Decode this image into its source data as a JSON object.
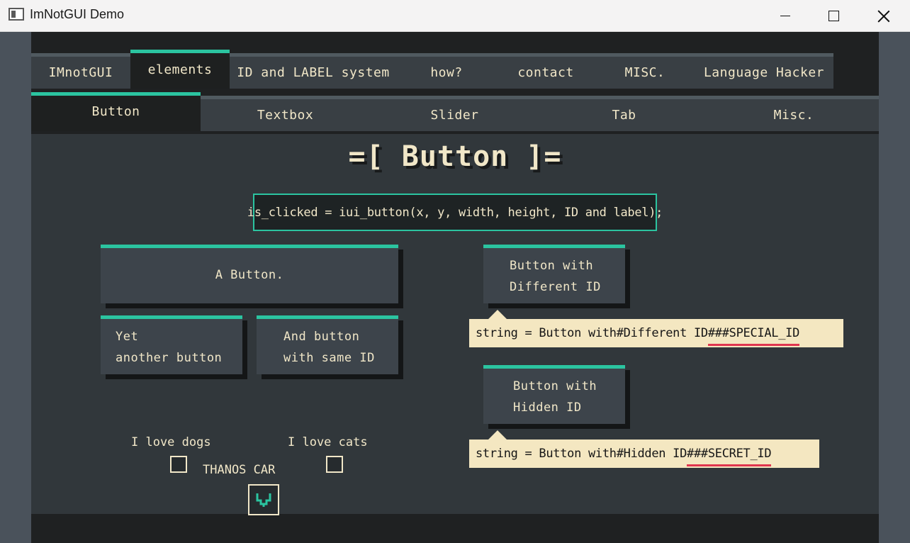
{
  "window": {
    "title": "ImNotGUI Demo",
    "icons": {
      "app": "app-window-icon",
      "minimize": "minimize-icon",
      "maximize": "maximize-icon",
      "close": "close-icon"
    }
  },
  "main_tabs": [
    {
      "label": "IMnotGUI",
      "active": false
    },
    {
      "label": "elements",
      "active": true
    },
    {
      "label": "ID and LABEL system",
      "active": false
    },
    {
      "label": "how?",
      "active": false
    },
    {
      "label": "contact",
      "active": false
    },
    {
      "label": "MISC.",
      "active": false
    },
    {
      "label": "Language Hacker",
      "active": false
    }
  ],
  "sub_tabs": [
    {
      "label": "Button",
      "active": true
    },
    {
      "label": "Textbox",
      "active": false
    },
    {
      "label": "Slider",
      "active": false
    },
    {
      "label": "Tab",
      "active": false
    },
    {
      "label": "Misc.",
      "active": false
    }
  ],
  "heading": "=[ Button ]=",
  "code": "is_clicked = iui_button(x, y, width, height, ID and label);",
  "buttons": {
    "a_button": "A Button.",
    "yet_another": "Yet\nanother button",
    "same_id": "And button\nwith same ID",
    "different_id": "Button with\nDifferent ID",
    "hidden_id": "Button with\nHidden ID"
  },
  "tooltips": {
    "different_prefix": "string = Button with#Different ID",
    "different_id": "###SPECIAL_ID",
    "hidden_prefix": "string = Button with#Hidden ID",
    "hidden_id": "###SECRET_ID"
  },
  "checkboxes": {
    "dogs": {
      "label": "I love dogs",
      "checked": false
    },
    "cats": {
      "label": "I love cats",
      "checked": false
    },
    "thanos": {
      "label": "THANOS CAR",
      "checked": true,
      "check_icon": "checkmark-icon"
    }
  },
  "colors": {
    "accent": "#2bc4a0",
    "text": "#f1e7c8",
    "tooltip_bg": "#f4e7c1",
    "id_underline": "#e0354f",
    "panel": "#31373b",
    "button": "#3d444b"
  }
}
